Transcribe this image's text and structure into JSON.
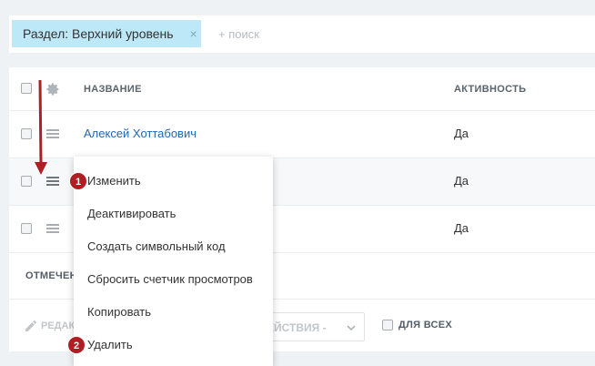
{
  "filter": {
    "chip_label": "Раздел: Верхний уровень",
    "chip_close": "×",
    "search_placeholder": "+ поиск"
  },
  "grid": {
    "headers": {
      "name": "НАЗВАНИЕ",
      "active": "АКТИВНОСТЬ"
    },
    "rows": [
      {
        "name": "Алексей Хоттабович",
        "active": "Да"
      },
      {
        "name": "",
        "active": "Да"
      },
      {
        "name": "",
        "active": "Да"
      }
    ],
    "footer_label": "ОТМЕЧЕН"
  },
  "actions": {
    "edit_label": "РЕДАК",
    "select_label": "ЕЙСТВИЯ -",
    "for_all_label": "ДЛЯ ВСЕХ"
  },
  "context_menu": {
    "items": [
      {
        "label": "Изменить"
      },
      {
        "label": "Деактивировать"
      },
      {
        "label": "Создать символьный код"
      },
      {
        "label": "Сбросить счетчик просмотров"
      },
      {
        "label": "Копировать"
      },
      {
        "label": "Удалить"
      }
    ]
  },
  "annotations": {
    "badge1": "1",
    "badge2": "2",
    "accent_color": "#b01e23"
  }
}
